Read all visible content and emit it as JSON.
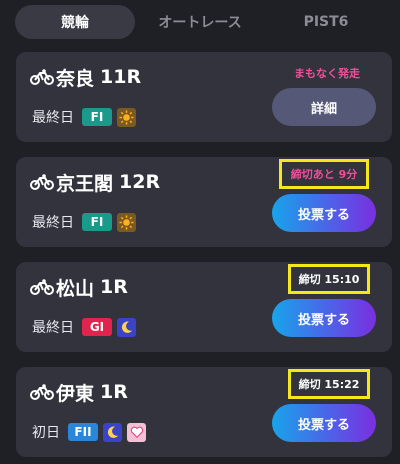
{
  "tabs": [
    "競輪",
    "オートレース",
    "PIST6"
  ],
  "races": [
    {
      "venue": "奈良",
      "race": "11R",
      "day": "最終日",
      "grade": "FI",
      "icons": [
        "sun-icon"
      ],
      "status": "まもなく発走",
      "button": "詳細"
    },
    {
      "venue": "京王閣",
      "race": "12R",
      "day": "最終日",
      "grade": "FI",
      "icons": [
        "sun-icon"
      ],
      "status": "締切あと 9分",
      "button": "投票する"
    },
    {
      "venue": "松山",
      "race": "1R",
      "day": "最終日",
      "grade": "GI",
      "icons": [
        "moon-icon"
      ],
      "status": "締切 15:10",
      "button": "投票する"
    },
    {
      "venue": "伊東",
      "race": "1R",
      "day": "初日",
      "grade": "FII",
      "icons": [
        "moon-icon",
        "heart-icon"
      ],
      "status": "締切 15:22",
      "button": "投票する"
    }
  ],
  "colors": {
    "background": "#1f1f26",
    "card": "#33333d",
    "accent_pink": "#ef4f9a",
    "highlight_yellow": "#f4e81a",
    "grade_fi": "#1a9a8a",
    "grade_gi": "#e0244d",
    "grade_fii": "#2a86d8"
  }
}
